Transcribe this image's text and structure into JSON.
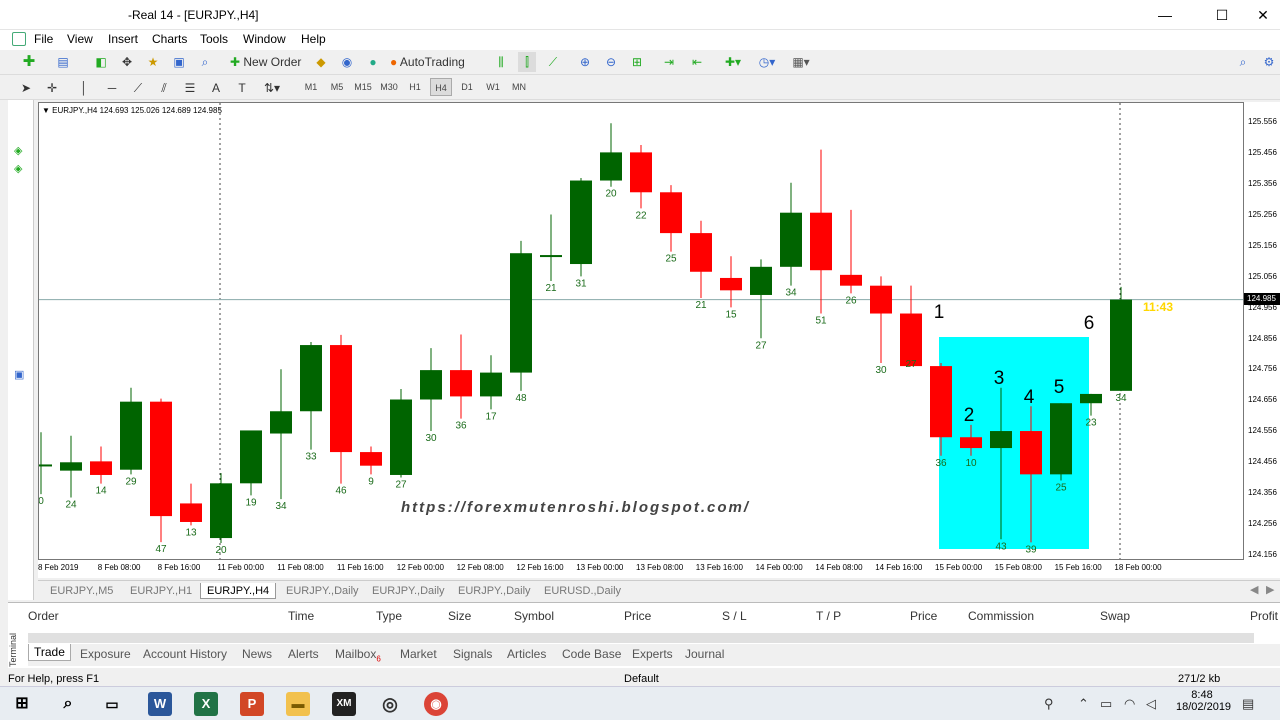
{
  "window": {
    "title": "-Real 14 - [EURJPY.,H4]",
    "minimize": "—",
    "maximize": "☐",
    "close": "✕"
  },
  "menu": [
    "File",
    "View",
    "Insert",
    "Charts",
    "Tools",
    "Window",
    "Help"
  ],
  "toolbar": {
    "new_order": "New Order",
    "auto_trading": "AutoTrading"
  },
  "timeframes": [
    "M1",
    "M5",
    "M15",
    "M30",
    "H1",
    "H4",
    "D1",
    "W1",
    "MN"
  ],
  "active_timeframe": "H4",
  "chart": {
    "header": "EURJPY.,H4  124.693 125.026 124.689 124.985",
    "watermark": "https://forexmutenroshi.blogspot.com/",
    "countdown": "11:43",
    "current_price": "124.985",
    "annotations": [
      "1",
      "2",
      "3",
      "4",
      "5",
      "6"
    ],
    "colors": {
      "bull": "#006400",
      "bear": "#ff0000",
      "highlight": "#00ffff",
      "countdown": "#ffd700"
    }
  },
  "chart_data": {
    "type": "candlestick",
    "symbol": "EURJPY.",
    "timeframe": "H4",
    "price_ticks": [
      "125.556",
      "125.456",
      "125.356",
      "125.256",
      "125.156",
      "125.056",
      "124.956",
      "124.856",
      "124.756",
      "124.656",
      "124.556",
      "124.456",
      "124.356",
      "124.256",
      "124.156"
    ],
    "time_ticks": [
      "8 Feb 2019",
      "8 Feb 08:00",
      "8 Feb 16:00",
      "11 Feb 00:00",
      "11 Feb 08:00",
      "11 Feb 16:00",
      "12 Feb 00:00",
      "12 Feb 08:00",
      "12 Feb 16:00",
      "13 Feb 00:00",
      "13 Feb 08:00",
      "13 Feb 16:00",
      "14 Feb 00:00",
      "14 Feb 08:00",
      "14 Feb 16:00",
      "15 Feb 00:00",
      "15 Feb 08:00",
      "15 Feb 16:00",
      "18 Feb 00:00"
    ],
    "candles": [
      {
        "o": 124.452,
        "h": 124.556,
        "l": 124.356,
        "c": 124.452,
        "label": "0"
      },
      {
        "o": 124.432,
        "h": 124.545,
        "l": 124.345,
        "c": 124.459,
        "label": "24"
      },
      {
        "o": 124.462,
        "h": 124.51,
        "l": 124.39,
        "c": 124.418,
        "label": "14"
      },
      {
        "o": 124.435,
        "h": 124.7,
        "l": 124.42,
        "c": 124.655,
        "label": "29"
      },
      {
        "o": 124.655,
        "h": 124.665,
        "l": 124.201,
        "c": 124.285,
        "label": "47"
      },
      {
        "o": 124.326,
        "h": 124.39,
        "l": 124.255,
        "c": 124.266,
        "label": "13"
      },
      {
        "o": 124.214,
        "h": 124.424,
        "l": 124.198,
        "c": 124.391,
        "label": "20"
      },
      {
        "o": 124.391,
        "h": 124.552,
        "l": 124.352,
        "c": 124.562,
        "label": "19"
      },
      {
        "o": 124.552,
        "h": 124.76,
        "l": 124.34,
        "c": 124.624,
        "label": "34"
      },
      {
        "o": 124.624,
        "h": 124.848,
        "l": 124.5,
        "c": 124.838,
        "label": "33"
      },
      {
        "o": 124.838,
        "h": 124.871,
        "l": 124.39,
        "c": 124.492,
        "label": "46"
      },
      {
        "o": 124.492,
        "h": 124.51,
        "l": 124.42,
        "c": 124.448,
        "label": "9"
      },
      {
        "o": 124.418,
        "h": 124.696,
        "l": 124.41,
        "c": 124.662,
        "label": "27"
      },
      {
        "o": 124.662,
        "h": 124.828,
        "l": 124.56,
        "c": 124.757,
        "label": "30"
      },
      {
        "o": 124.757,
        "h": 124.872,
        "l": 124.6,
        "c": 124.672,
        "label": "36"
      },
      {
        "o": 124.672,
        "h": 124.805,
        "l": 124.63,
        "c": 124.749,
        "label": "17"
      },
      {
        "o": 124.749,
        "h": 125.175,
        "l": 124.69,
        "c": 125.135,
        "label": "48"
      },
      {
        "o": 125.129,
        "h": 125.26,
        "l": 125.045,
        "c": 125.129,
        "label": "21"
      },
      {
        "o": 125.1,
        "h": 125.378,
        "l": 125.06,
        "c": 125.37,
        "label": "31"
      },
      {
        "o": 125.37,
        "h": 125.555,
        "l": 125.35,
        "c": 125.461,
        "label": "20"
      },
      {
        "o": 125.461,
        "h": 125.485,
        "l": 125.28,
        "c": 125.332,
        "label": "22"
      },
      {
        "o": 125.332,
        "h": 125.355,
        "l": 125.14,
        "c": 125.2,
        "label": "25"
      },
      {
        "o": 125.2,
        "h": 125.24,
        "l": 124.99,
        "c": 125.075,
        "label": "21"
      },
      {
        "o": 125.055,
        "h": 125.125,
        "l": 124.96,
        "c": 125.015,
        "label": "15"
      },
      {
        "o": 125.0,
        "h": 125.115,
        "l": 124.86,
        "c": 125.091,
        "label": "27"
      },
      {
        "o": 125.091,
        "h": 125.363,
        "l": 125.03,
        "c": 125.266,
        "label": "34"
      },
      {
        "o": 125.266,
        "h": 125.47,
        "l": 124.94,
        "c": 125.08,
        "label": "51"
      },
      {
        "o": 125.065,
        "h": 125.275,
        "l": 125.005,
        "c": 125.03,
        "label": "26"
      },
      {
        "o": 125.03,
        "h": 125.06,
        "l": 124.78,
        "c": 124.94,
        "label": "30"
      },
      {
        "o": 124.94,
        "h": 125.03,
        "l": 124.8,
        "c": 124.77,
        "label": "27"
      },
      {
        "o": 124.77,
        "h": 124.78,
        "l": 124.48,
        "c": 124.54,
        "label": "36"
      },
      {
        "o": 124.54,
        "h": 124.58,
        "l": 124.48,
        "c": 124.505,
        "label": "10"
      },
      {
        "o": 124.505,
        "h": 124.7,
        "l": 124.21,
        "c": 124.56,
        "label": "43"
      },
      {
        "o": 124.56,
        "h": 124.64,
        "l": 124.2,
        "c": 124.42,
        "label": "39"
      },
      {
        "o": 124.42,
        "h": 124.65,
        "l": 124.4,
        "c": 124.65,
        "label": "25"
      },
      {
        "o": 124.65,
        "h": 124.68,
        "l": 124.61,
        "c": 124.68,
        "label": "23"
      },
      {
        "o": 124.69,
        "h": 125.026,
        "l": 124.689,
        "c": 124.985,
        "label": "34"
      }
    ]
  },
  "chart_tabs": [
    "EURJPY.,M5",
    "EURJPY.,H1",
    "EURJPY.,H4",
    "EURJPY.,Daily",
    "EURJPY.,Daily",
    "EURJPY.,Daily",
    "EURUSD.,Daily"
  ],
  "active_chart_tab": "EURJPY.,H4",
  "terminal": {
    "side_label": "Terminal",
    "columns": [
      "Order",
      "Time",
      "Type",
      "Size",
      "Symbol",
      "Price",
      "S / L",
      "T / P",
      "Price",
      "Commission",
      "Swap",
      "Profit"
    ],
    "tabs": [
      "Trade",
      "Exposure",
      "Account History",
      "News",
      "Alerts",
      "Mailbox",
      "Market",
      "Signals",
      "Articles",
      "Code Base",
      "Experts",
      "Journal"
    ],
    "mailbox_count": "6",
    "active_tab": "Trade"
  },
  "status": {
    "help": "For Help, press F1",
    "profile": "Default",
    "traffic": "271/2 kb"
  },
  "taskbar": {
    "time": "8:48",
    "date": "18/02/2019"
  }
}
